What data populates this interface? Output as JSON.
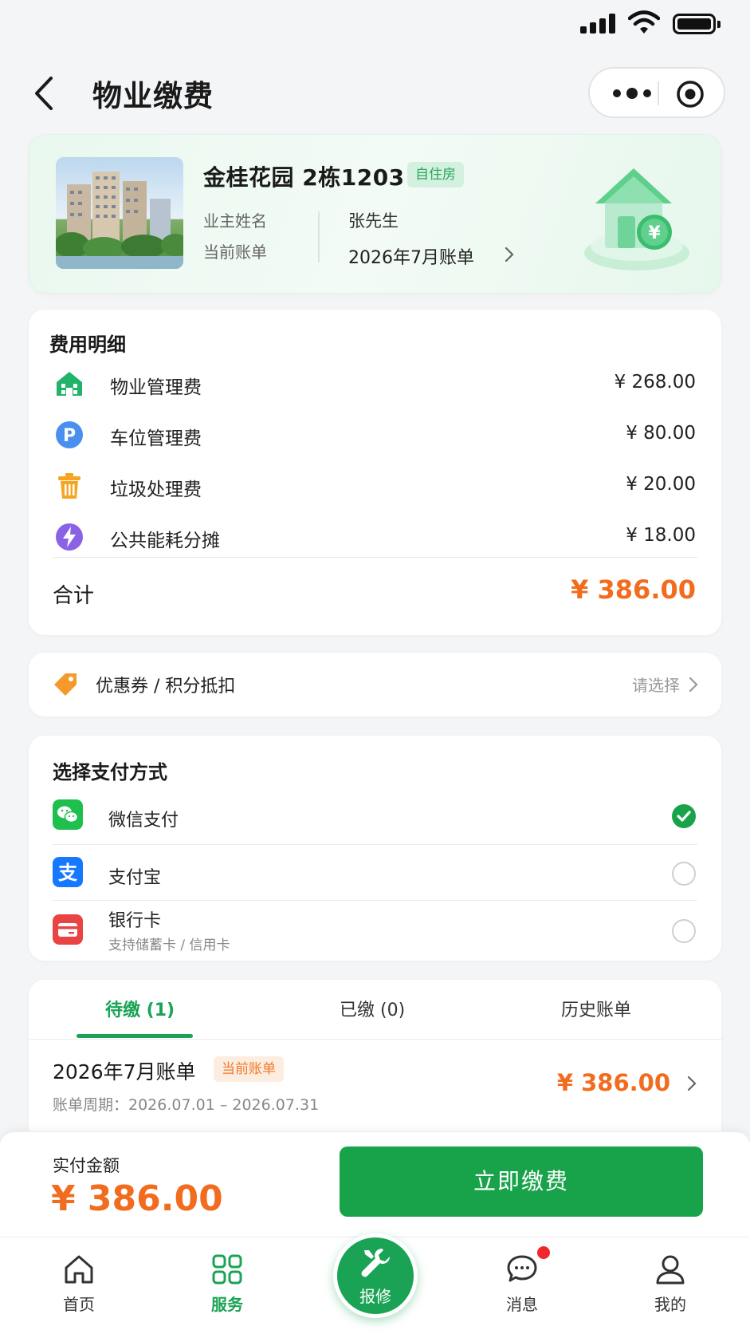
{
  "nav": {
    "title": "物业缴费"
  },
  "property": {
    "name": "金桂花园  2栋1203",
    "tag": "自住房",
    "owner_label": "业主姓名",
    "owner_value": "张先生",
    "bill_label": "当前账单",
    "bill_value": "2026年7月账单"
  },
  "fees": {
    "title": "费用明细",
    "items": [
      {
        "name": "物业管理费",
        "amount": "¥ 268.00",
        "icon": "building-icon"
      },
      {
        "name": "车位管理费",
        "amount": "¥ 80.00",
        "icon": "parking-icon"
      },
      {
        "name": "垃圾处理费",
        "amount": "¥ 20.00",
        "icon": "trash-icon"
      },
      {
        "name": "公共能耗分摊",
        "amount": "¥ 18.00",
        "icon": "energy-icon"
      }
    ],
    "total_label": "合计",
    "total_amount": "¥ 386.00"
  },
  "coupon": {
    "label": "优惠券 / 积分抵扣",
    "action": "请选择"
  },
  "payment": {
    "title": "选择支付方式",
    "methods": [
      {
        "name": "微信支付",
        "sub": "",
        "selected": true
      },
      {
        "name": "支付宝",
        "sub": "",
        "selected": false
      },
      {
        "name": "银行卡",
        "sub": "支持储蓄卡 / 信用卡",
        "selected": false
      }
    ]
  },
  "bills": {
    "tabs": [
      "待缴 (1)",
      "已缴 (0)",
      "历史账单"
    ],
    "active_tab": 0,
    "item": {
      "title": "2026年7月账单",
      "tag": "当前账单",
      "period": "账单周期：2026.07.01 – 2026.07.31",
      "amount": "¥ 386.00"
    }
  },
  "paybar": {
    "label": "实付金额",
    "amount": "¥ 386.00",
    "button": "立即缴费"
  },
  "tabbar": {
    "items": [
      "首页",
      "服务",
      "报修",
      "消息",
      "我的"
    ],
    "active": 1
  },
  "colors": {
    "brand": "#1aa355",
    "price": "#f26c1f",
    "tag_bg": "#d4f1e0"
  }
}
